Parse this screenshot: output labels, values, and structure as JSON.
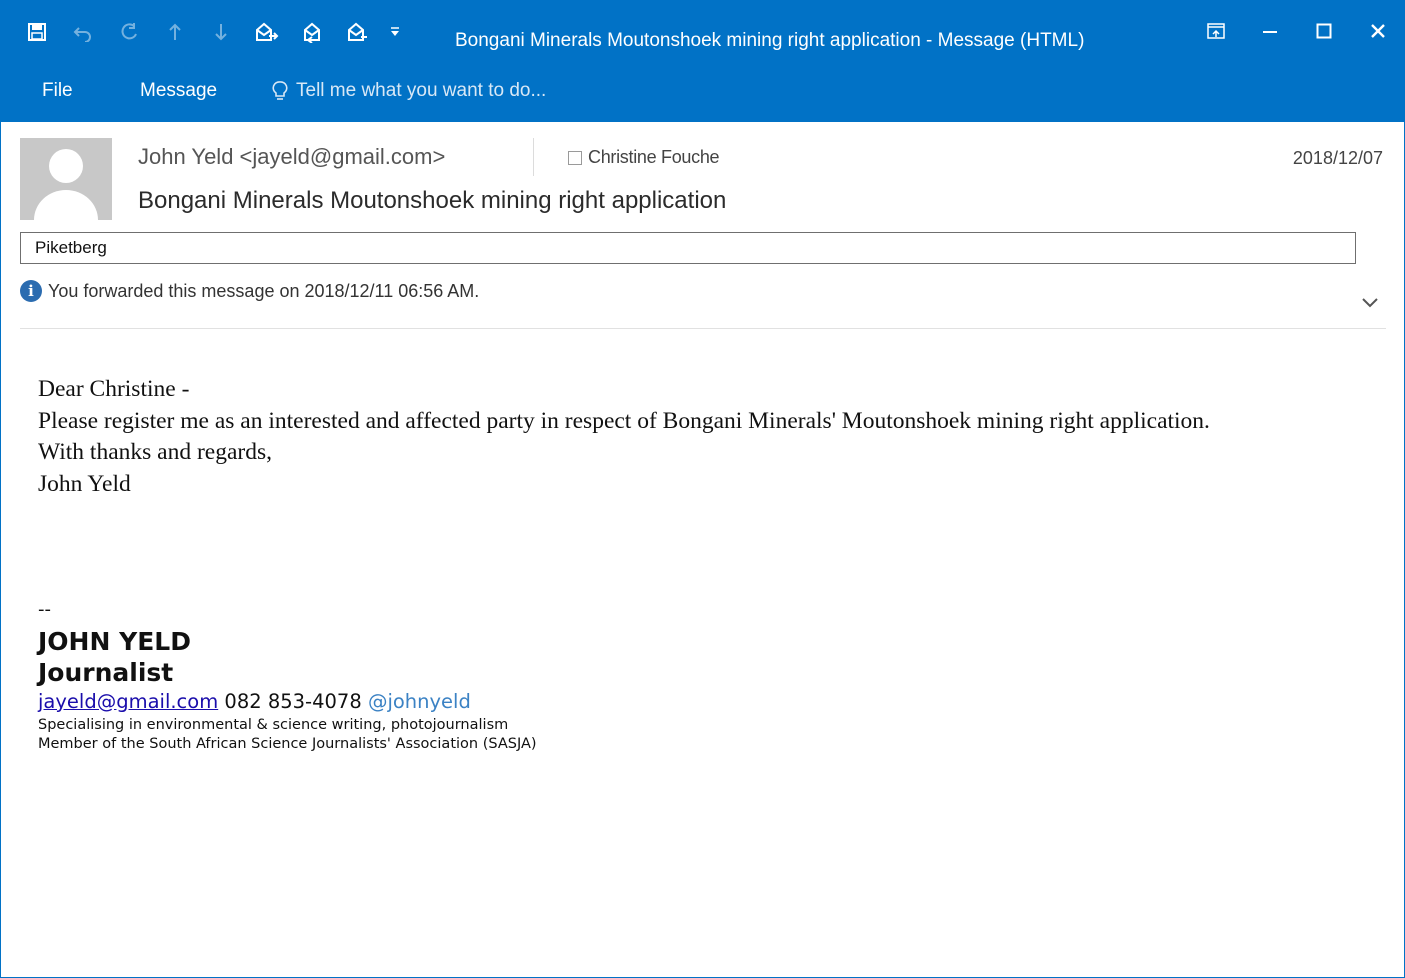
{
  "window": {
    "title": "Bongani Minerals Moutonshoek mining right application - Message (HTML)"
  },
  "qat": {
    "icons": [
      "save-icon",
      "undo-icon",
      "redo-icon",
      "previous-item-icon",
      "next-item-icon",
      "reply-icon",
      "reply-all-icon",
      "forward-icon",
      "customize-qat-icon"
    ]
  },
  "menu": {
    "file": "File",
    "message": "Message",
    "tell_me_placeholder": "Tell me what you want to do..."
  },
  "header": {
    "sender": "John Yeld <jayeld@gmail.com>",
    "recipient": "Christine Fouche",
    "date": "2018/12/07",
    "subject": "Bongani Minerals Moutonshoek mining right application",
    "category": "Piketberg",
    "info": "You forwarded this message on 2018/12/11 06:56 AM."
  },
  "body": {
    "greeting": "Dear Christine -",
    "paragraph": "Please register me as an interested and affected party in respect of Bongani Minerals' Moutonshoek mining right application.",
    "closing": "With thanks and regards,",
    "name": "John Yeld"
  },
  "signature": {
    "dash": "--",
    "name": "JOHN YELD",
    "role": "Journalist",
    "email": "jayeld@gmail.com",
    "phone": "082 853-4078",
    "handle": "@johnyeld",
    "line1": "Specialising in environmental & science writing, photojournalism",
    "line2": "Member of the South African Science Journalists' Association (SASJA)"
  },
  "colors": {
    "accent": "#0172c6",
    "link": "#1a0dab",
    "handle": "#3b82c4",
    "info_icon": "#2b6cb0"
  }
}
